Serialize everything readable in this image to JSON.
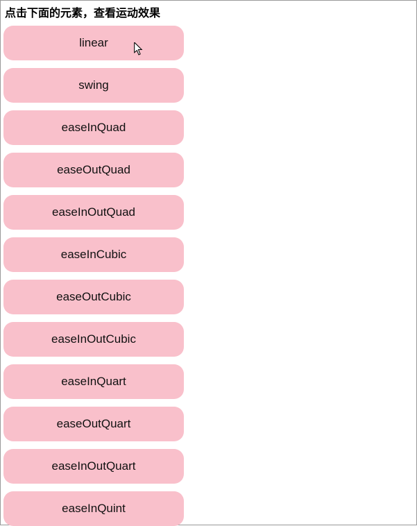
{
  "heading": "点击下面的元素，查看运动效果",
  "easings": [
    {
      "label": "linear"
    },
    {
      "label": "swing"
    },
    {
      "label": "easeInQuad"
    },
    {
      "label": "easeOutQuad"
    },
    {
      "label": "easeInOutQuad"
    },
    {
      "label": "easeInCubic"
    },
    {
      "label": "easeOutCubic"
    },
    {
      "label": "easeInOutCubic"
    },
    {
      "label": "easeInQuart"
    },
    {
      "label": "easeOutQuart"
    },
    {
      "label": "easeInOutQuart"
    },
    {
      "label": "easeInQuint"
    }
  ]
}
